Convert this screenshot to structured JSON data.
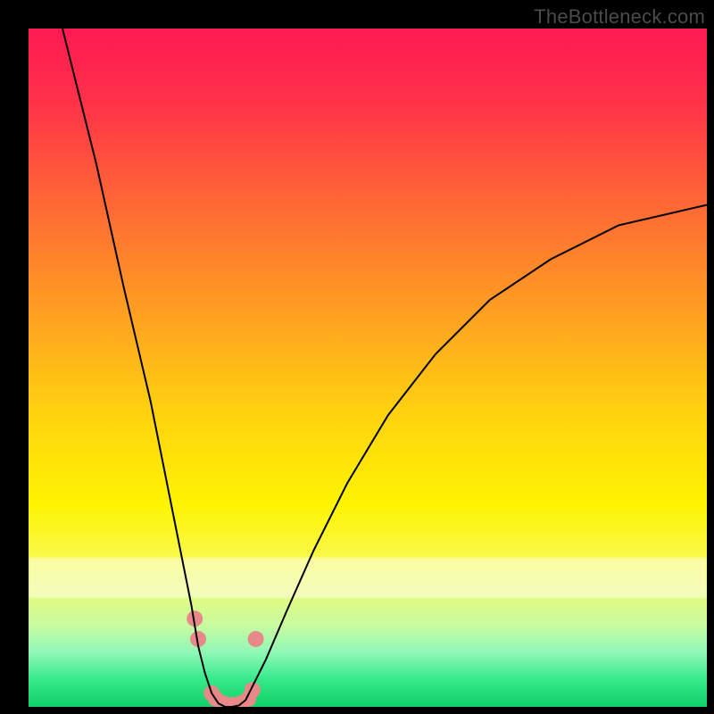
{
  "watermark": "TheBottleneck.com",
  "chart_data": {
    "type": "line",
    "title": "",
    "xlabel": "",
    "ylabel": "",
    "xlim": [
      0,
      100
    ],
    "ylim": [
      0,
      100
    ],
    "grid": false,
    "legend": false,
    "annotations": [],
    "background_gradient": {
      "top": "#ff1a52",
      "upper_mid": "#ffa71f",
      "mid": "#fef400",
      "lower": "#35e98a"
    },
    "series": [
      {
        "name": "curve",
        "color": "#000000",
        "width": 2,
        "x": [
          5,
          10,
          14,
          18,
          20,
          22,
          24,
          25,
          26,
          27,
          28,
          29,
          30,
          31,
          32,
          33,
          35,
          38,
          42,
          47,
          53,
          60,
          68,
          77,
          87,
          100
        ],
        "y": [
          100,
          80,
          62,
          45,
          35,
          25,
          15,
          9,
          5,
          2,
          0.5,
          0,
          0,
          0.2,
          1,
          3,
          7,
          14,
          23,
          33,
          43,
          52,
          60,
          66,
          71,
          74
        ]
      },
      {
        "name": "markers",
        "type": "scatter",
        "color": "#e98888",
        "radius": 9,
        "x": [
          24.5,
          25.0,
          27.0,
          27.6,
          28.7,
          30.0,
          31.3,
          32.4,
          33.0,
          33.5
        ],
        "y": [
          13.0,
          10.0,
          2.0,
          1.2,
          0.5,
          0.3,
          0.5,
          1.2,
          2.5,
          10.0
        ]
      }
    ]
  }
}
